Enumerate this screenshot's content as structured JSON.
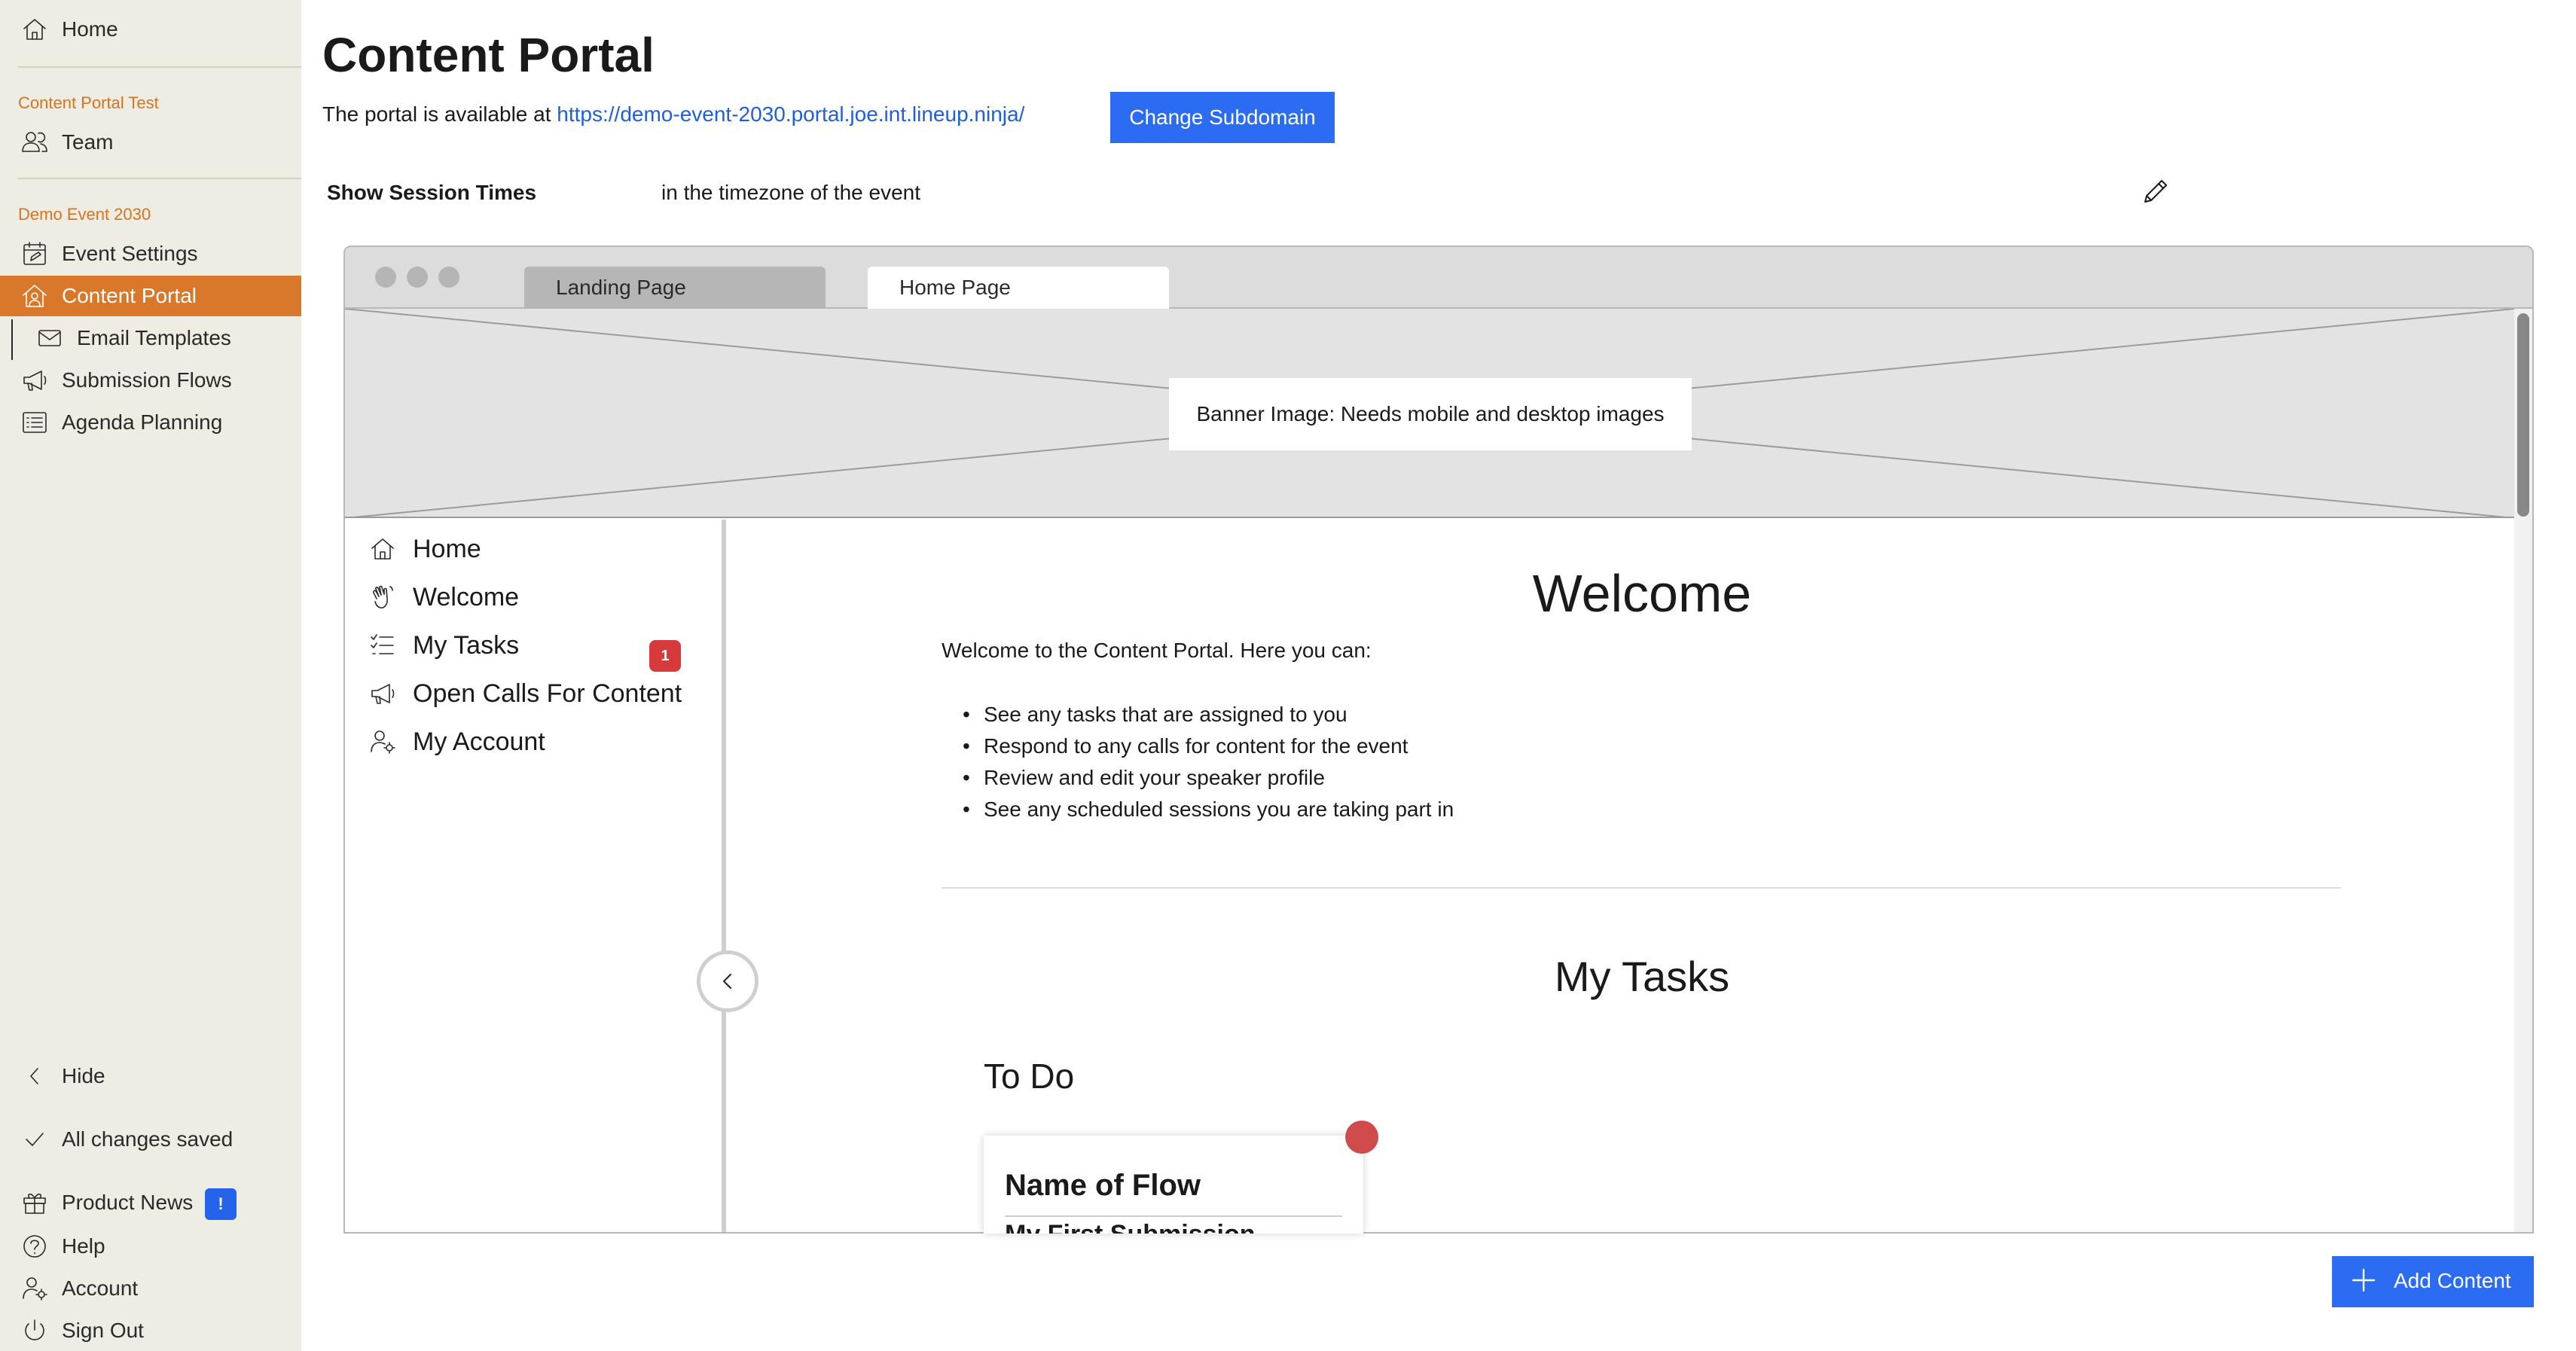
{
  "sidebar": {
    "home_label": "Home",
    "section_team": "Content Portal Test",
    "team_label": "Team",
    "section_event": "Demo Event 2030",
    "items": [
      {
        "label": "Event Settings",
        "icon": "calendar-edit-icon"
      },
      {
        "label": "Content Portal",
        "icon": "house-person-icon",
        "active": true
      },
      {
        "label": "Email Templates",
        "icon": "envelope-icon"
      },
      {
        "label": "Submission Flows",
        "icon": "megaphone-icon"
      },
      {
        "label": "Agenda Planning",
        "icon": "list-icon"
      }
    ],
    "hide_label": "Hide",
    "saved_label": "All changes saved",
    "product_news_label": "Product News",
    "product_news_badge": "!",
    "help_label": "Help",
    "account_label": "Account",
    "signout_label": "Sign Out",
    "active_color": "#d9772b",
    "section_color": "#d9731f"
  },
  "header": {
    "title": "Content Portal",
    "portal_prefix": "The portal is available at",
    "portal_url": "https://demo-event-2030.portal.joe.int.lineup.ninja/",
    "change_subdomain_label": "Change Subdomain",
    "session_times_label": "Show Session Times",
    "session_times_value": "in the timezone of the event"
  },
  "preview": {
    "tabs": [
      {
        "label": "Landing Page",
        "active": false
      },
      {
        "label": "Home Page",
        "active": true
      }
    ],
    "banner_label": "Banner Image: Needs mobile and desktop images",
    "nav": [
      {
        "label": "Home",
        "icon": "home-icon"
      },
      {
        "label": "Welcome",
        "icon": "wave-hand-icon"
      },
      {
        "label": "My Tasks",
        "icon": "checklist-icon",
        "badge": "1"
      },
      {
        "label": "Open Calls For Content",
        "icon": "megaphone-icon"
      },
      {
        "label": "My Account",
        "icon": "user-settings-icon"
      }
    ],
    "welcome_title": "Welcome",
    "welcome_intro": "Welcome to the Content Portal. Here you can:",
    "welcome_points": [
      "See any tasks that are assigned to you",
      "Respond to any calls for content for the event",
      "Review and edit your speaker profile",
      "See any scheduled sessions you are taking part in"
    ],
    "tasks_title": "My Tasks",
    "todo_title": "To Do",
    "task_card_title": "Name of Flow",
    "task_card_subtitle": "My First Submission"
  },
  "actions": {
    "add_content_label": "Add Content"
  },
  "colors": {
    "primary_button": "#2b6cf2",
    "badge_red": "#d63a3a"
  }
}
